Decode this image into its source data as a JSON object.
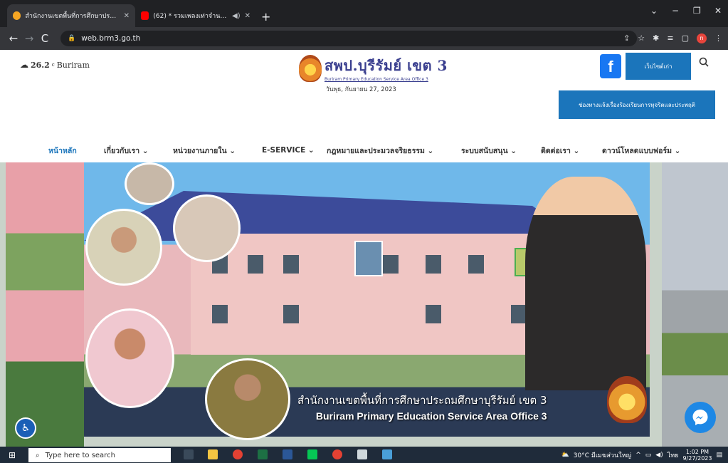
{
  "browser": {
    "tabs": [
      {
        "title": "สำนักงานเขตพื้นที่การศึกษาประถมศึ",
        "active": true,
        "favicon_color": "#f5a623"
      },
      {
        "title": "(62) * รวมเพลงเท่าจำนวนนับยุค 8",
        "active": false,
        "favicon_color": "#ff0000",
        "audio": "◀)"
      }
    ],
    "new_tab": "+",
    "url": "web.brm3.go.th",
    "window_controls": [
      "⌄",
      "−",
      "❐",
      "✕"
    ],
    "profile_initial": "n"
  },
  "header": {
    "weather_icon": "cloud-sun-icon",
    "temperature": "26.2",
    "temp_unit": "c",
    "city": "Buriram",
    "logo_title": "สพป.บุรีรัมย์ เขต 3",
    "logo_subtitle": "Buriram Primary Education Service Area Office 3",
    "date": "วันพุธ, กันยายน 27, 2023",
    "facebook_label": "f",
    "old_web_label": "เว็บไซต์เก่า",
    "report_label": "ช่องทางแจ้งเรื่องร้องเรียนการทุจริตและประพฤติ"
  },
  "menu": {
    "items": [
      {
        "label": "หน้าหลัก",
        "active": true
      },
      {
        "label": "เกี่ยวกับเรา ⌄",
        "active": false
      },
      {
        "label": "หน่วยงานภายใน ⌄",
        "active": false
      },
      {
        "label": "E-SERVICE ⌄",
        "active": false
      },
      {
        "label": "กฎหมายและประมวลจริยธรรม ⌄",
        "active": false
      },
      {
        "label": "ระบบสนับสนุน ⌄",
        "active": false
      },
      {
        "label": "ติดต่อเรา ⌄",
        "active": false
      },
      {
        "label": "ดาวน์โหลดแบบฟอร์ม ⌄",
        "active": false
      }
    ]
  },
  "banner": {
    "caption_th": "สำนักงานเขตพื้นที่การศึกษาประถมศึกษาบุรีรัมย์ เขต 3",
    "caption_en": "Buriram Primary Education Service Area Office 3"
  },
  "taskbar": {
    "search_placeholder": "Type here to search",
    "weather": "30°C มีเมฆส่วนใหญ่",
    "lang": "ไทย",
    "time": "1:02 PM",
    "date": "9/27/2023"
  },
  "colors": {
    "accent": "#1b75bb",
    "brand": "#3a3f8f",
    "chrome_dark": "#202124"
  }
}
